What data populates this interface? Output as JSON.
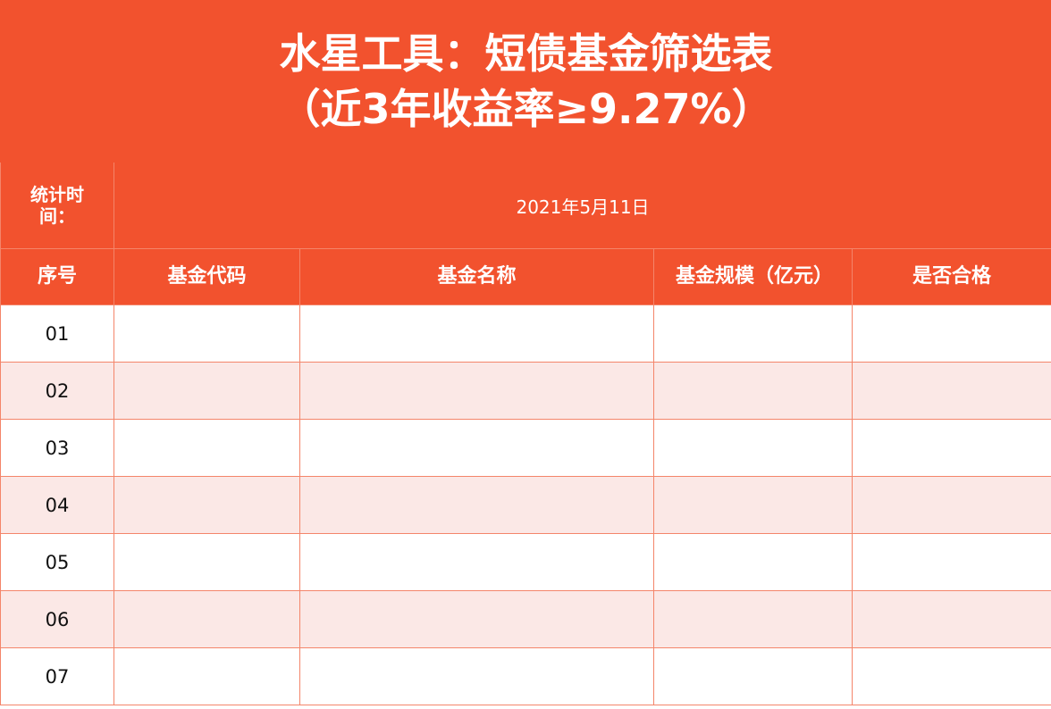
{
  "title": {
    "line1": "水星工具：短债基金筛选表",
    "line2": "（近3年收益率≥9.27%）"
  },
  "meta": {
    "label": "统计时间：",
    "value": "2021年5月11日"
  },
  "headers": [
    "序号",
    "基金代码",
    "基金名称",
    "基金规模（亿元）",
    "是否合格"
  ],
  "rows": [
    {
      "index": "01",
      "code": "",
      "name": "",
      "size": "",
      "qualified": ""
    },
    {
      "index": "02",
      "code": "",
      "name": "",
      "size": "",
      "qualified": ""
    },
    {
      "index": "03",
      "code": "",
      "name": "",
      "size": "",
      "qualified": ""
    },
    {
      "index": "04",
      "code": "",
      "name": "",
      "size": "",
      "qualified": ""
    },
    {
      "index": "05",
      "code": "",
      "name": "",
      "size": "",
      "qualified": ""
    },
    {
      "index": "06",
      "code": "",
      "name": "",
      "size": "",
      "qualified": ""
    },
    {
      "index": "07",
      "code": "",
      "name": "",
      "size": "",
      "qualified": ""
    }
  ],
  "colors": {
    "accent": "#f2522e",
    "stripe": "#fbe8e6",
    "border": "#f4856a"
  }
}
